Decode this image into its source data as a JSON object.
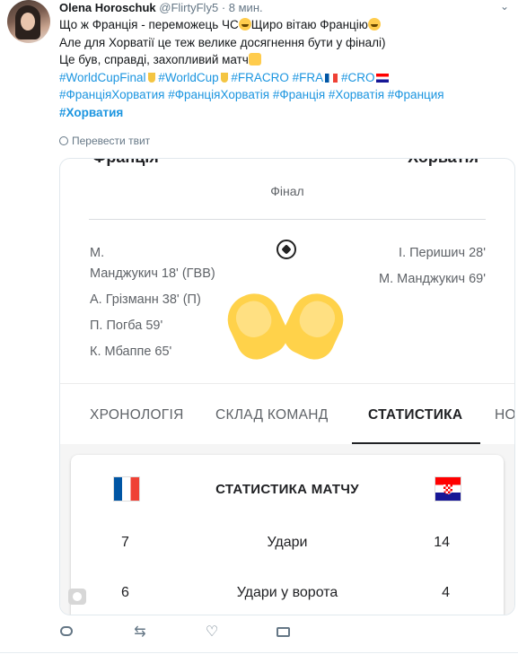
{
  "tweet": {
    "name": "Olena Horoschuk",
    "handle": "@FlirtyFly5",
    "time": "8 мин.",
    "line1_a": "Що ж Франція - переможець ЧС",
    "line1_b": "Щиро вітаю Францію",
    "line2": "Але для Хорватії це теж велике досягнення бути у фіналі)",
    "line3": "Це був, справді, захопливий матч",
    "hashtags_line4": [
      "#WorldCupFinal",
      "#WorldCup",
      "#FRACRO",
      "#FRA",
      "#CRO"
    ],
    "hashtags_line5": [
      "#ФранціяХорватия",
      "#ФранціяХорватія",
      "#Франція",
      "#Хорватія",
      "#Франция"
    ],
    "hashtag_bold": "#Хорватия",
    "translate": "Перевести твит"
  },
  "match": {
    "team_left": "Франція",
    "team_right": "Хорватія",
    "stage": "Фінал",
    "scorers_left": [
      "М.",
      "Манджукич 18' (ГВВ)",
      "А. Грізманн 38' (П)",
      "П. Погба 59'",
      "К. Мбаппе 65'"
    ],
    "scorers_right": [
      "І. Перишич 28'",
      "М. Манджукич 69'"
    ],
    "tabs": [
      "ХРОНОЛОГІЯ",
      "СКЛАД КОМАНД",
      "СТАТИСТИКА",
      "НО"
    ],
    "active_tab": "СТАТИСТИКА",
    "stats_title": "СТАТИСТИКА МАТЧУ",
    "stats": [
      {
        "left": "7",
        "label": "Удари",
        "right": "14"
      },
      {
        "left": "6",
        "label": "Удари у ворота",
        "right": "4"
      }
    ]
  },
  "actions": {
    "reply": "reply-icon",
    "retweet": "retweet-icon",
    "like": "heart-icon",
    "dm": "message-icon"
  }
}
